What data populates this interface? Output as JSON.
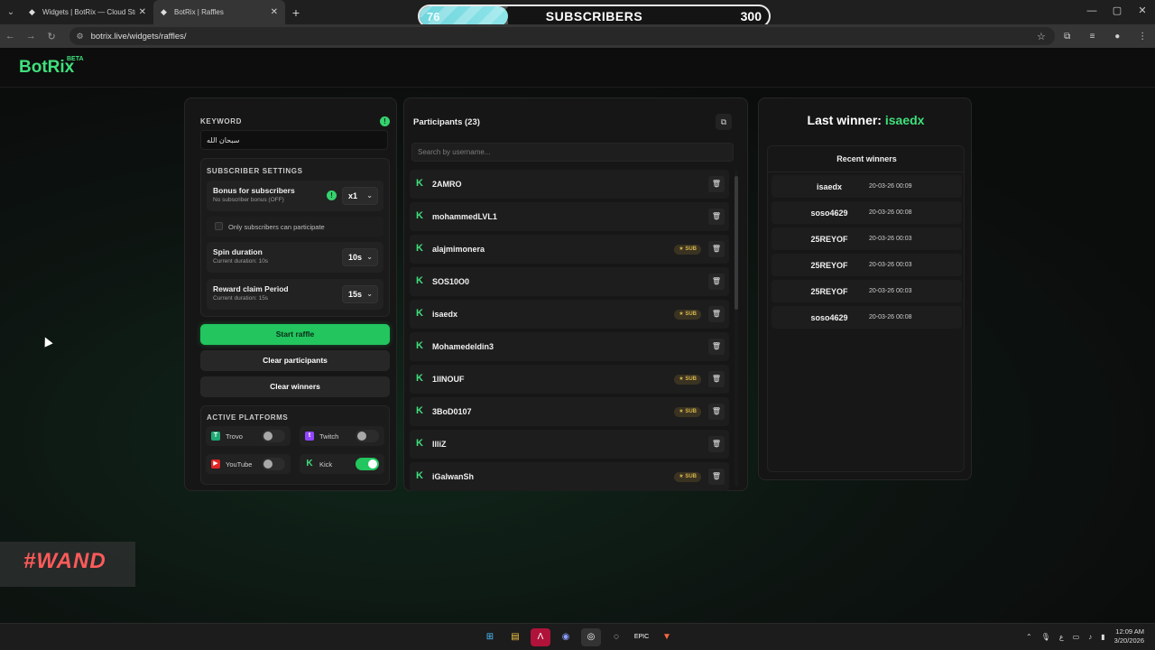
{
  "browser": {
    "tabs": [
      {
        "title": "Widgets | BotRix — Cloud Strea",
        "active": false
      },
      {
        "title": "BotRix | Raffles",
        "active": true
      }
    ],
    "url": "botrix.live/widgets/raffles/"
  },
  "subscriber_goal": {
    "current": "76",
    "title": "SUBSCRIBERS",
    "goal": "300",
    "progress_fraction": 0.253
  },
  "app": {
    "logo": "BotRix",
    "badge": "BETA"
  },
  "settings": {
    "keyword_label": "KEYWORD",
    "keyword_value": "سبحان الله",
    "subscriber_settings_label": "SUBSCRIBER SETTINGS",
    "bonus": {
      "title": "Bonus for subscribers",
      "subtitle": "No subscriber bonus (OFF)",
      "value": "x1"
    },
    "only_subs_label": "Only subscribers can participate",
    "spin": {
      "title": "Spin duration",
      "subtitle": "Current duration: 10s",
      "value": "10s"
    },
    "claim": {
      "title": "Reward claim Period",
      "subtitle": "Current duration: 15s",
      "value": "15s"
    },
    "start_label": "Start raffle",
    "clear_participants_label": "Clear participants",
    "clear_winners_label": "Clear winners",
    "platforms_label": "ACTIVE PLATFORMS",
    "platforms": [
      {
        "name": "Trovo",
        "enabled": false
      },
      {
        "name": "Twitch",
        "enabled": false
      },
      {
        "name": "YouTube",
        "enabled": false
      },
      {
        "name": "Kick",
        "enabled": true
      }
    ]
  },
  "participants": {
    "title": "Participants (23)",
    "search_placeholder": "Search by username...",
    "sub_badge": "SUB",
    "items": [
      {
        "name": "2AMRO",
        "sub": false
      },
      {
        "name": "mohammedLVL1",
        "sub": false
      },
      {
        "name": "alajmimonera",
        "sub": true
      },
      {
        "name": "SOS10O0",
        "sub": false
      },
      {
        "name": "isaedx",
        "sub": true
      },
      {
        "name": "Mohamedeldin3",
        "sub": false
      },
      {
        "name": "1lINOUF",
        "sub": true
      },
      {
        "name": "3BoD0107",
        "sub": true
      },
      {
        "name": "llliZ",
        "sub": false
      },
      {
        "name": "iGalwanSh",
        "sub": true
      }
    ]
  },
  "winners": {
    "last_label": "Last winner:",
    "last_name": "isaedx",
    "recent_label": "Recent winners",
    "items": [
      {
        "name": "isaedx",
        "date": "20-03-26 00:09"
      },
      {
        "name": "soso4629",
        "date": "20-03-26 00:08"
      },
      {
        "name": "25REYOF",
        "date": "20-03-26 00:03"
      },
      {
        "name": "25REYOF",
        "date": "20-03-26 00:03"
      },
      {
        "name": "25REYOF",
        "date": "20-03-26 00:03"
      },
      {
        "name": "soso4629",
        "date": "20-03-26 00:08"
      }
    ]
  },
  "overlay_logo": "#WAND",
  "taskbar": {
    "time": "12:09 AM",
    "date": "3/20/2026",
    "lang": "ع"
  },
  "colors": {
    "accent": "#22c55e",
    "brand": "#3fe07c",
    "sub_fill": "#7ddde3"
  }
}
